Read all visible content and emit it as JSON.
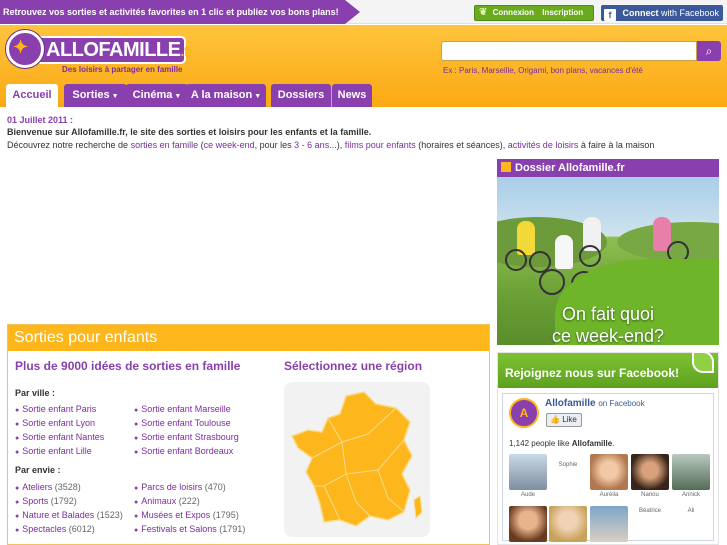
{
  "topbar": {
    "promo": "Retrouvez vos sorties et activités favorites en 1 clic et publiez vos bons plans!",
    "login": "Connexion",
    "register": "Inscription",
    "facebook_connect_prefix": "Connect",
    "facebook_connect_suffix": "with Facebook"
  },
  "header": {
    "logo_text": "ALLOFAMILLE",
    "logo_ext": ".fr",
    "tagline": "Des loisirs à partager en famille",
    "search_placeholder": "",
    "search_hint": "Ex : Paris, Marseille, Origami, bon plans, vacances d'été"
  },
  "nav": {
    "tabs": [
      {
        "label": "Accueil",
        "dropdown": false,
        "active": true
      },
      {
        "label": "Sorties",
        "dropdown": true,
        "active": false
      },
      {
        "label": "Cinéma",
        "dropdown": true,
        "active": false
      },
      {
        "label": "A la maison",
        "dropdown": true,
        "active": false
      },
      {
        "label": "Dossiers",
        "dropdown": false,
        "active": false
      },
      {
        "label": "News",
        "dropdown": false,
        "active": false
      }
    ]
  },
  "intro": {
    "date": "01 Juillet 2011 :",
    "welcome": "Bienvenue sur Allofamille.fr, le site des sorties et loisirs pour les enfants et la famille.",
    "discover_prefix": "Découvrez notre recherche de ",
    "link_sorties": "sorties en famille",
    "paren_open": " (",
    "link_weekend": "ce week-end",
    "text_pour": ", pour les ",
    "link_age": "3 - 6 ans...",
    "text_close": "), ",
    "link_films": "films pour enfants",
    "text_horaires": " (horaires et séances), ",
    "link_activites": "activités de loisirs",
    "text_end": " à faire à la maison"
  },
  "dossier": {
    "title": "Dossier Allofamille.fr",
    "slogan_line1": "On fait quoi",
    "slogan_line2": "ce week-end?"
  },
  "sorties": {
    "header": "Sorties pour enfants",
    "title": "Plus de 9000 idées de sorties en famille",
    "region_title": "Sélectionnez une région",
    "par_ville": "Par ville :",
    "villes_col1": [
      "Sortie enfant Paris",
      "Sortie enfant Lyon",
      "Sortie enfant Nantes",
      "Sortie enfant Lille"
    ],
    "villes_col2": [
      "Sortie enfant Marseille",
      "Sortie enfant Toulouse",
      "Sortie enfant Strasbourg",
      "Sortie enfant Bordeaux"
    ],
    "par_envie": "Par envie :",
    "envies_col1": [
      {
        "label": "Ateliers",
        "count": "(3528)"
      },
      {
        "label": "Sports",
        "count": "(1792)"
      },
      {
        "label": "Nature et Balades",
        "count": "(1523)"
      },
      {
        "label": "Spectacles",
        "count": "(6012)"
      }
    ],
    "envies_col2": [
      {
        "label": "Parcs de loisirs",
        "count": "(470)"
      },
      {
        "label": "Animaux",
        "count": "(222)"
      },
      {
        "label": "Musées et Expos",
        "count": "(1795)"
      },
      {
        "label": "Festivals et Salons",
        "count": "(1791)"
      }
    ]
  },
  "facebook": {
    "header": "Rejoignez nous sur Facebook!",
    "page_name": "Allofamille",
    "on_facebook": "on Facebook",
    "like": "Like",
    "count_prefix": "1,142 people like ",
    "count_name": "Allofamille",
    "count_suffix": ".",
    "faces": [
      "Aude",
      "Sophie",
      "Auréila",
      "Nanou",
      "Annick",
      "Béatrice",
      "Ali"
    ]
  },
  "colors": {
    "purple": "#8a3fae",
    "orange": "#fdb61c",
    "green": "#6fb52a",
    "facebook": "#3b5998"
  }
}
